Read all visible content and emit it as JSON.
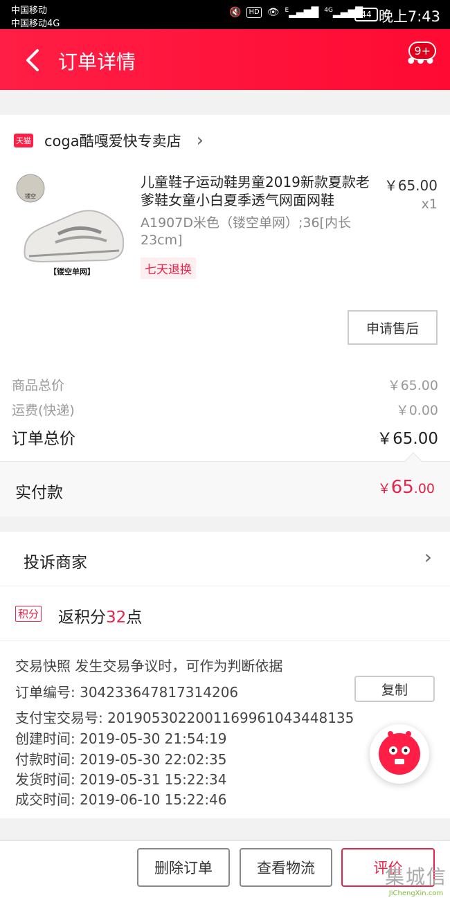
{
  "status_bar": {
    "carrier_1": "中国移动",
    "carrier_2": "中国移动4G",
    "hd": "HD",
    "signal_1": "E",
    "signal_2": "4G",
    "battery": "44",
    "time": "晚上7:43"
  },
  "nav": {
    "title": "订单详情",
    "badge": "9+"
  },
  "store": {
    "badge": "天猫",
    "name": "coga酷嘎爱快专卖店"
  },
  "product": {
    "title": "儿童鞋子运动鞋男童2019新款夏款老爹鞋女童小白夏季透气网面网鞋",
    "price": "￥65.00",
    "quantity": "x1",
    "sku": "A1907D米色（镂空单网）;36[内长23cm]",
    "tag": "七天退换",
    "image_caption": "【镂空单网】",
    "image_chip": "镂空",
    "aftersale_label": "申请售后"
  },
  "summary": {
    "subtotal_label": "商品总价",
    "subtotal_value": "￥65.00",
    "shipping_label": "运费(快递)",
    "shipping_value": "￥0.00",
    "total_label": "订单总价",
    "total_value": "￥65.00",
    "paid_label": "实付款",
    "paid_currency": "￥",
    "paid_integer": "65",
    "paid_decimal": ".00"
  },
  "complain": {
    "label": "投诉商家"
  },
  "points": {
    "icon_label": "积分",
    "prefix": "返积分",
    "amount": "32",
    "suffix": "点"
  },
  "snapshot": {
    "title": "交易快照  发生交易争议时，可作为判断依据",
    "order_no": "订单编号: 304233647817314206",
    "copy_label": "复制",
    "alipay_no": "支付宝交易号: 2019053022001169961043448135",
    "created": "创建时间: 2019-05-30 21:54:19",
    "paid": "付款时间: 2019-05-30 22:02:35",
    "shipped": "发货时间: 2019-05-31 15:22:34",
    "completed": "成交时间: 2019-06-10 15:22:46"
  },
  "actions": {
    "delete_label": "删除订单",
    "logistics_label": "查看物流",
    "rate_label": "评价"
  },
  "watermark": {
    "top": "集城信",
    "bottom": "JiChengXin.com"
  },
  "colors": {
    "brand_red": "#ff1e45",
    "accent_red": "#e8234a"
  }
}
